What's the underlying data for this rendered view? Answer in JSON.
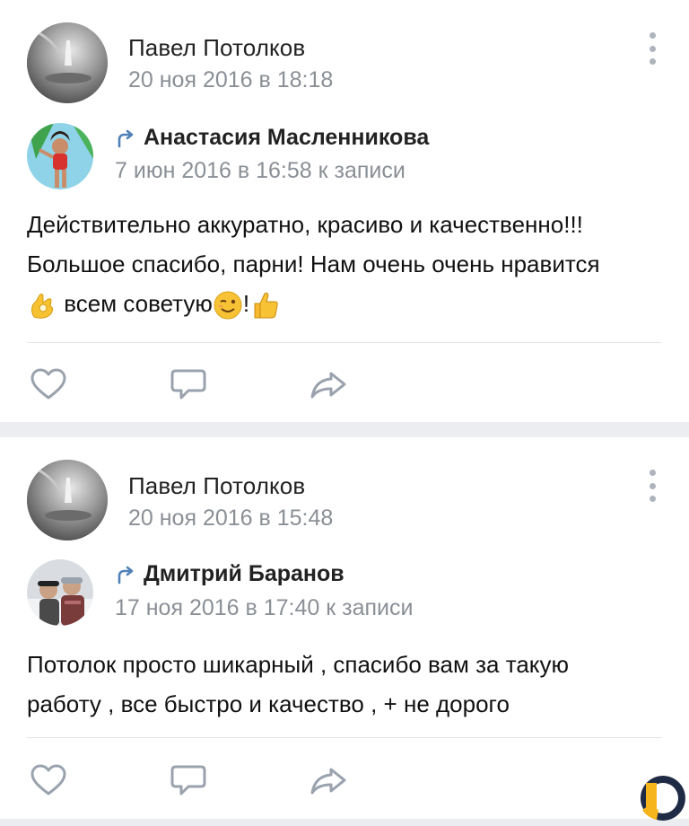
{
  "posts": [
    {
      "author": "Павел Потолков",
      "date": "20 ноя 2016 в 18:18",
      "repost": {
        "name": "Анастасия Масленникова",
        "date": "7 июн 2016 в 16:58 к записи"
      },
      "text_line_1": "Действительно аккуратно, красиво и качественно!!!",
      "text_line_2": "Большое спасибо, парни! Нам очень очень нравится",
      "text_line_3_a": "всем советую",
      "text_line_3_b": "!",
      "emojis": [
        "ok-hand-emoji",
        "winking-face-emoji",
        "thumbs-up-emoji"
      ]
    },
    {
      "author": "Павел Потолков",
      "date": "20 ноя 2016 в 15:48",
      "repost": {
        "name": "Дмитрий Баранов",
        "date": "17 ноя 2016 в 17:40 к записи"
      },
      "text_line_1": "Потолок просто шикарный , спасибо вам за такую",
      "text_line_2": "работу , все быстро и качество , + не дорого"
    }
  ],
  "icons": {
    "like": "heart-icon",
    "comment": "comment-icon",
    "share": "share-icon",
    "menu": "more-vertical-icon",
    "repost": "repost-arrow-icon"
  },
  "colors": {
    "background": "#ebedf0",
    "card": "#ffffff",
    "text": "#222222",
    "secondary_text": "#8a8f96",
    "accent": "#5181b8",
    "icon": "#aeb4bb"
  }
}
